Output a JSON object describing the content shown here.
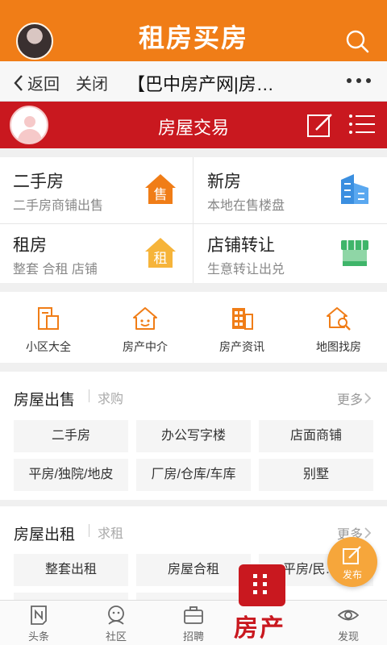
{
  "header": {
    "title": "租房买房",
    "icons": [
      "avatar",
      "search-icon"
    ]
  },
  "nav": {
    "back_label": "返回",
    "close_label": "关闭",
    "page_title": "【巴中房产网|房…",
    "icons": [
      "chevron-left-icon",
      "more-dots-icon"
    ]
  },
  "banner": {
    "title": "房屋交易",
    "icons": [
      "user-avatar-icon",
      "edit-icon",
      "list-menu-icon"
    ]
  },
  "categories": [
    {
      "title": "二手房",
      "subtitle": "二手房商铺出售",
      "icon": "sale-house-icon",
      "icon_text": "售",
      "color": "#f07d17"
    },
    {
      "title": "新房",
      "subtitle": "本地在售楼盘",
      "icon": "building-icon",
      "color": "#3b8fe0"
    },
    {
      "title": "租房",
      "subtitle": "整套 合租 店铺",
      "icon": "rent-house-icon",
      "icon_text": "租",
      "color": "#f6b43a"
    },
    {
      "title": "店铺转让",
      "subtitle": "生意转让出兑",
      "icon": "shop-icon",
      "color": "#3fb56a"
    }
  ],
  "quick_links": [
    {
      "label": "小区大全",
      "icon": "community-icon"
    },
    {
      "label": "房产中介",
      "icon": "agent-house-icon"
    },
    {
      "label": "房产资讯",
      "icon": "news-building-icon"
    },
    {
      "label": "地图找房",
      "icon": "map-search-icon"
    }
  ],
  "sale_section": {
    "title": "房屋出售",
    "sub": "求购",
    "more": "更多",
    "tags": [
      "二手房",
      "办公写字楼",
      "店面商铺",
      "平房/独院/地皮",
      "厂房/仓库/车库",
      "别墅"
    ]
  },
  "rent_section": {
    "title": "房屋出租",
    "sub": "求租",
    "more": "更多",
    "tags": [
      "整套出租",
      "房屋合租",
      "平房/民…"
    ]
  },
  "fab": {
    "label": "发布",
    "icon": "edit-icon"
  },
  "tabbar": {
    "tabs": [
      {
        "label": "头条",
        "icon": "headline-icon"
      },
      {
        "label": "社区",
        "icon": "community-face-icon"
      },
      {
        "label": "招聘",
        "icon": "briefcase-icon"
      },
      {
        "label": "发现",
        "icon": "eye-icon"
      }
    ],
    "center": {
      "label": "房产",
      "icon": "building-grid-icon"
    }
  },
  "colors": {
    "accent_orange": "#f07d17",
    "accent_red": "#c9181f"
  }
}
